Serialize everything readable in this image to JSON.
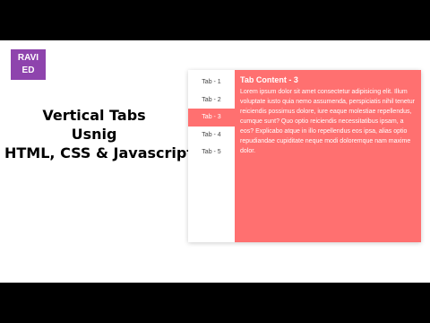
{
  "logo": {
    "line1": "RAVI",
    "line2": "ED",
    "color": "#8e44ad"
  },
  "title": {
    "line1": "Vertical Tabs",
    "line2": "Usnig",
    "line3": "HTML, CSS & Javascript"
  },
  "tabs": [
    {
      "label": "Tab - 1",
      "active": false
    },
    {
      "label": "Tab - 2",
      "active": false
    },
    {
      "label": "Tab - 3",
      "active": true
    },
    {
      "label": "Tab - 4",
      "active": false
    },
    {
      "label": "Tab - 5",
      "active": false
    }
  ],
  "content": {
    "heading": "Tab Content - 3",
    "text": "Lorem ipsum dolor sit amet consectetur adipisicing elit. Illum voluptate iusto quia nemo assumenda, perspiciatis nihil tenetur reiciendis possimus dolore, iure eaque molestiae repellendus, cumque sunt? Quo optio reiciendis necessitatibus ipsam, a eos? Explicabo atque in illo repellendus eos ipsa, alias optio repudiandae cupiditate neque modi doloremque nam maxime dolor."
  },
  "colors": {
    "accent": "#ff7070",
    "bars": "#000000"
  }
}
